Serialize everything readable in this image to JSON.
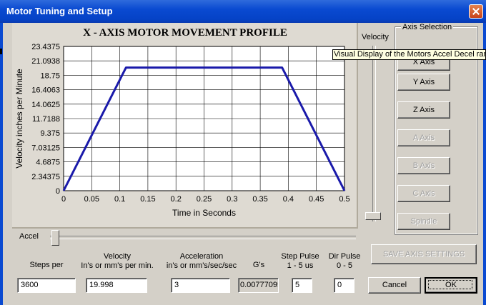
{
  "window": {
    "title": "Motor Tuning and Setup"
  },
  "chart_data": {
    "type": "line",
    "title": "X - AXIS MOTOR MOVEMENT PROFILE",
    "xlabel": "Time in Seconds",
    "ylabel": "Velocity inches per Minute",
    "x_ticks": [
      "0",
      "0.05",
      "0.1",
      "0.15",
      "0.2",
      "0.25",
      "0.3",
      "0.35",
      "0.4",
      "0.45",
      "0.5"
    ],
    "y_ticks": [
      "0",
      "2.34375",
      "4.6875",
      "7.03125",
      "9.375",
      "11.7188",
      "14.0625",
      "16.4063",
      "18.75",
      "21.0938",
      "23.4375"
    ],
    "xlim": [
      0,
      0.5
    ],
    "ylim": [
      0,
      23.4375
    ],
    "grid": true,
    "series": [
      {
        "color": "#1a1aaa",
        "x": [
          0,
          0.111,
          0.389,
          0.5
        ],
        "y": [
          0,
          19.998,
          19.998,
          0
        ]
      }
    ]
  },
  "velocity_slider": {
    "label": "Velocity",
    "level": 0.05
  },
  "axis_selection": {
    "label": "Axis Selection",
    "buttons": [
      {
        "label": "X Axis",
        "enabled": true
      },
      {
        "label": "Y Axis",
        "enabled": true
      },
      {
        "label": "Z Axis",
        "enabled": true
      },
      {
        "label": "A Axis",
        "enabled": false
      },
      {
        "label": "B Axis",
        "enabled": false
      },
      {
        "label": "C Axis",
        "enabled": false
      },
      {
        "label": "Spindle",
        "enabled": false
      }
    ]
  },
  "tooltip": "Visual Display of the Motors Accel  Decel ramp",
  "accel_slider": {
    "label": "Accel",
    "level": 0.02
  },
  "fields": {
    "steps_per": {
      "caption": "Steps per",
      "value": "3600"
    },
    "velocity": {
      "caption1": "Velocity",
      "caption2": "In's or mm's per min.",
      "value": "19.998"
    },
    "acceleration": {
      "caption1": "Acceleration",
      "caption2": "in's or mm's/sec/sec",
      "value": "3"
    },
    "gs": {
      "caption": "G's",
      "value": "0.00777095"
    },
    "step_pulse": {
      "caption1": "Step Pulse",
      "caption2": "1 - 5 us",
      "value": "5"
    },
    "dir_pulse": {
      "caption1": "Dir Pulse",
      "caption2": "0 - 5",
      "value": "0"
    }
  },
  "buttons": {
    "save": "SAVE AXIS SETTINGS",
    "cancel": "Cancel",
    "ok": "OK"
  }
}
